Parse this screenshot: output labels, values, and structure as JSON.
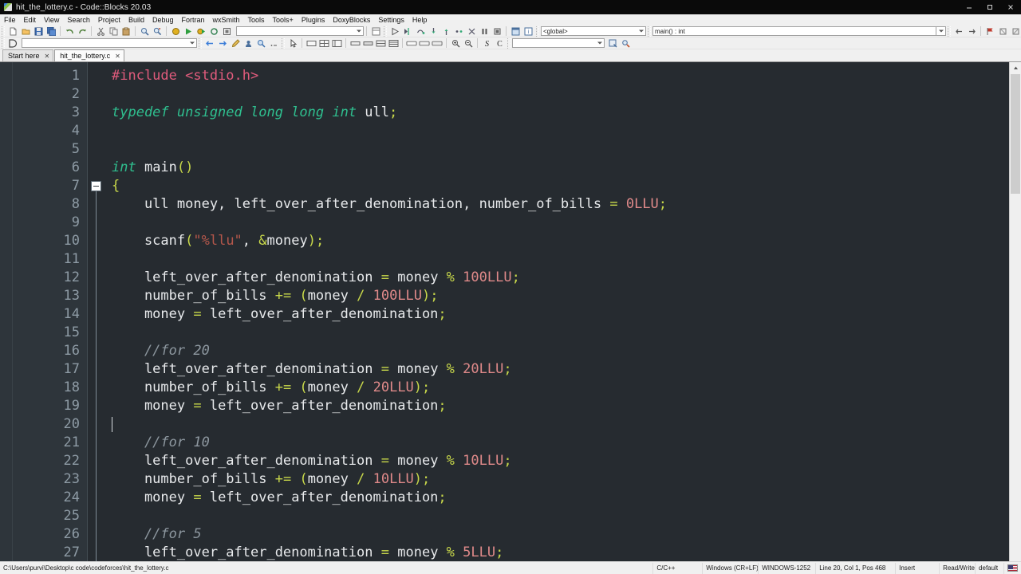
{
  "window": {
    "title": "hit_the_lottery.c - Code::Blocks 20.03",
    "icon": "codeblocks-icon",
    "minimize": "—",
    "maximize": "☐",
    "close": "✕"
  },
  "menubar": {
    "items": [
      "File",
      "Edit",
      "View",
      "Search",
      "Project",
      "Build",
      "Debug",
      "Fortran",
      "wxSmith",
      "Tools",
      "Tools+",
      "Plugins",
      "DoxyBlocks",
      "Settings",
      "Help"
    ]
  },
  "toolbar_main": {
    "build_target_value": "",
    "scope_value": "<global>",
    "symbol_value": "main() : int",
    "buttons": [
      "new-file-icon",
      "open-file-icon",
      "save-icon",
      "save-all-icon",
      "undo-icon",
      "redo-icon",
      "cut-icon",
      "copy-icon",
      "paste-icon",
      "find-icon",
      "replace-icon",
      "build-icon",
      "run-icon",
      "build-and-run-icon",
      "rebuild-icon",
      "abort-icon",
      "debug-continue-icon",
      "debug-run-to-cursor-icon",
      "debug-next-line-icon",
      "debug-step-into-icon",
      "debug-step-out-icon",
      "debug-next-instruction-icon",
      "debug-step-into-instruction-icon",
      "debug-break-icon",
      "debug-stop-icon",
      "debugging-windows-icon",
      "various-info-icon"
    ]
  },
  "toolbar_second": {
    "doxyblocks_value": "",
    "search_value": "",
    "buttons": [
      "doxyblocks-icon",
      "back-icon",
      "forward-icon",
      "highlight-icon",
      "goto-icon",
      "search-decl-icon",
      "more-icon",
      "pointer-icon",
      "panel-icon",
      "grid-icon",
      "list-icon",
      "hbox-icon",
      "hbox2-icon",
      "vbox-icon",
      "table-icon",
      "box-icon",
      "box2-icon",
      "box3-icon",
      "zoom-in-icon",
      "zoom-out-icon",
      "symbol-s-icon",
      "symbol-c-icon",
      "find-symbol-icon",
      "settings-search-icon"
    ]
  },
  "toolbar_debug": {
    "buttons": [
      "prev-icon",
      "next-icon",
      "breakpoint-icon",
      "breakpoint2-icon",
      "breakpoint3-icon",
      "breakpoint4-icon",
      "tool1-icon",
      "tool2-icon",
      "bookmark1-icon",
      "bookmark2-icon",
      "window1-icon",
      "window2-icon",
      "wrench-icon",
      "step-back-icon",
      "step-dot-icon",
      "step-forward-icon"
    ]
  },
  "tabs": [
    {
      "label": "Start here",
      "close": "✕",
      "active": false
    },
    {
      "label": "hit_the_lottery.c",
      "close": "✕",
      "active": true
    }
  ],
  "editor": {
    "first_line": 1,
    "last_line": 27,
    "fold_marker_line": 7,
    "caret_line": 20,
    "caret_col": 1,
    "lines": [
      {
        "n": 1,
        "tokens": [
          {
            "t": "pp",
            "v": "#include <stdio.h>"
          }
        ]
      },
      {
        "n": 2,
        "tokens": []
      },
      {
        "n": 3,
        "tokens": [
          {
            "t": "k",
            "v": "typedef unsigned long long int"
          },
          {
            "t": "id",
            "v": " ull"
          },
          {
            "t": "br",
            "v": ";"
          }
        ]
      },
      {
        "n": 4,
        "tokens": []
      },
      {
        "n": 5,
        "tokens": []
      },
      {
        "n": 6,
        "tokens": [
          {
            "t": "k",
            "v": "int"
          },
          {
            "t": "id",
            "v": " main"
          },
          {
            "t": "br",
            "v": "()"
          }
        ]
      },
      {
        "n": 7,
        "tokens": [
          {
            "t": "br",
            "v": "{"
          }
        ]
      },
      {
        "n": 8,
        "tokens": [
          {
            "t": "id",
            "v": "    ull money, left_over_after_denomination, number_of_bills "
          },
          {
            "t": "op",
            "v": "="
          },
          {
            "t": "id",
            "v": " "
          },
          {
            "t": "nm",
            "v": "0LLU"
          },
          {
            "t": "br",
            "v": ";"
          }
        ]
      },
      {
        "n": 9,
        "tokens": []
      },
      {
        "n": 10,
        "tokens": [
          {
            "t": "id",
            "v": "    scanf"
          },
          {
            "t": "br",
            "v": "("
          },
          {
            "t": "st",
            "v": "\"%llu\""
          },
          {
            "t": "id",
            "v": ", "
          },
          {
            "t": "op",
            "v": "&"
          },
          {
            "t": "id",
            "v": "money"
          },
          {
            "t": "br",
            "v": ")"
          },
          {
            "t": "br",
            "v": ";"
          }
        ]
      },
      {
        "n": 11,
        "tokens": []
      },
      {
        "n": 12,
        "tokens": [
          {
            "t": "id",
            "v": "    left_over_after_denomination "
          },
          {
            "t": "op",
            "v": "="
          },
          {
            "t": "id",
            "v": " money "
          },
          {
            "t": "op",
            "v": "%"
          },
          {
            "t": "id",
            "v": " "
          },
          {
            "t": "nm",
            "v": "100LLU"
          },
          {
            "t": "br",
            "v": ";"
          }
        ]
      },
      {
        "n": 13,
        "tokens": [
          {
            "t": "id",
            "v": "    number_of_bills "
          },
          {
            "t": "op",
            "v": "+="
          },
          {
            "t": "id",
            "v": " "
          },
          {
            "t": "br",
            "v": "("
          },
          {
            "t": "id",
            "v": "money "
          },
          {
            "t": "op",
            "v": "/"
          },
          {
            "t": "id",
            "v": " "
          },
          {
            "t": "nm",
            "v": "100LLU"
          },
          {
            "t": "br",
            "v": ")"
          },
          {
            "t": "br",
            "v": ";"
          }
        ]
      },
      {
        "n": 14,
        "tokens": [
          {
            "t": "id",
            "v": "    money "
          },
          {
            "t": "op",
            "v": "="
          },
          {
            "t": "id",
            "v": " left_over_after_denomination"
          },
          {
            "t": "br",
            "v": ";"
          }
        ]
      },
      {
        "n": 15,
        "tokens": []
      },
      {
        "n": 16,
        "tokens": [
          {
            "t": "cm",
            "v": "    //for 20"
          }
        ]
      },
      {
        "n": 17,
        "tokens": [
          {
            "t": "id",
            "v": "    left_over_after_denomination "
          },
          {
            "t": "op",
            "v": "="
          },
          {
            "t": "id",
            "v": " money "
          },
          {
            "t": "op",
            "v": "%"
          },
          {
            "t": "id",
            "v": " "
          },
          {
            "t": "nm",
            "v": "20LLU"
          },
          {
            "t": "br",
            "v": ";"
          }
        ]
      },
      {
        "n": 18,
        "tokens": [
          {
            "t": "id",
            "v": "    number_of_bills "
          },
          {
            "t": "op",
            "v": "+="
          },
          {
            "t": "id",
            "v": " "
          },
          {
            "t": "br",
            "v": "("
          },
          {
            "t": "id",
            "v": "money "
          },
          {
            "t": "op",
            "v": "/"
          },
          {
            "t": "id",
            "v": " "
          },
          {
            "t": "nm",
            "v": "20LLU"
          },
          {
            "t": "br",
            "v": ")"
          },
          {
            "t": "br",
            "v": ";"
          }
        ]
      },
      {
        "n": 19,
        "tokens": [
          {
            "t": "id",
            "v": "    money "
          },
          {
            "t": "op",
            "v": "="
          },
          {
            "t": "id",
            "v": " left_over_after_denomination"
          },
          {
            "t": "br",
            "v": ";"
          }
        ]
      },
      {
        "n": 20,
        "tokens": []
      },
      {
        "n": 21,
        "tokens": [
          {
            "t": "cm",
            "v": "    //for 10"
          }
        ]
      },
      {
        "n": 22,
        "tokens": [
          {
            "t": "id",
            "v": "    left_over_after_denomination "
          },
          {
            "t": "op",
            "v": "="
          },
          {
            "t": "id",
            "v": " money "
          },
          {
            "t": "op",
            "v": "%"
          },
          {
            "t": "id",
            "v": " "
          },
          {
            "t": "nm",
            "v": "10LLU"
          },
          {
            "t": "br",
            "v": ";"
          }
        ]
      },
      {
        "n": 23,
        "tokens": [
          {
            "t": "id",
            "v": "    number_of_bills "
          },
          {
            "t": "op",
            "v": "+="
          },
          {
            "t": "id",
            "v": " "
          },
          {
            "t": "br",
            "v": "("
          },
          {
            "t": "id",
            "v": "money "
          },
          {
            "t": "op",
            "v": "/"
          },
          {
            "t": "id",
            "v": " "
          },
          {
            "t": "nm",
            "v": "10LLU"
          },
          {
            "t": "br",
            "v": ")"
          },
          {
            "t": "br",
            "v": ";"
          }
        ]
      },
      {
        "n": 24,
        "tokens": [
          {
            "t": "id",
            "v": "    money "
          },
          {
            "t": "op",
            "v": "="
          },
          {
            "t": "id",
            "v": " left_over_after_denomination"
          },
          {
            "t": "br",
            "v": ";"
          }
        ]
      },
      {
        "n": 25,
        "tokens": []
      },
      {
        "n": 26,
        "tokens": [
          {
            "t": "cm",
            "v": "    //for 5"
          }
        ]
      },
      {
        "n": 27,
        "tokens": [
          {
            "t": "id",
            "v": "    left_over_after_denomination "
          },
          {
            "t": "op",
            "v": "="
          },
          {
            "t": "id",
            "v": " money "
          },
          {
            "t": "op",
            "v": "%"
          },
          {
            "t": "id",
            "v": " "
          },
          {
            "t": "nm",
            "v": "5LLU"
          },
          {
            "t": "br",
            "v": ";"
          }
        ]
      }
    ]
  },
  "statusbar": {
    "file_path": "C:\\Users\\purvi\\Desktop\\c code\\codeforces\\hit_the_lottery.c",
    "language": "C/C++",
    "line_ending": "Windows (CR+LF)",
    "encoding": "WINDOWS-1252",
    "position": "Line 20, Col 1, Pos 468",
    "insert_mode": "Insert",
    "access_mode": "Read/Write",
    "profile": "default",
    "keyboard_layout": "us-flag-icon"
  },
  "colors": {
    "editor_bg": "#262b30",
    "gutter_bg": "#2e353b",
    "keyword": "#2fbf8f",
    "preprocessor": "#e05b7c",
    "number": "#e08a8a",
    "operator": "#c8d84a",
    "comment": "#8d979f",
    "string": "#b4574b",
    "identifier": "#e8eaec",
    "chrome": "#f0f0f0",
    "titlebar": "#0a0a0a"
  }
}
